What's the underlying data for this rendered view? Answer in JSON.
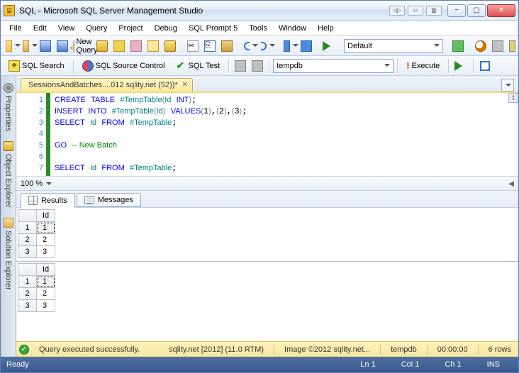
{
  "window": {
    "title": "SQL - Microsoft SQL Server Management Studio"
  },
  "menu": [
    "File",
    "Edit",
    "View",
    "Query",
    "Project",
    "Debug",
    "SQL Prompt 5",
    "Tools",
    "Window",
    "Help"
  ],
  "toolbar1": {
    "new_query": "New Query",
    "config_combo": "Default"
  },
  "toolbar2": {
    "sql_search": "SQL Search",
    "sql_source_control": "SQL Source Control",
    "sql_test": "SQL Test",
    "db_combo": "tempdb",
    "execute": "Execute"
  },
  "sidebar": {
    "properties": "Properties",
    "object_explorer": "Object Explorer",
    "solution_explorer": "Solution Explorer"
  },
  "document_tab": {
    "label": "SessionsAndBatches....012 sqlity.net (52))*"
  },
  "editor": {
    "lines": [
      1,
      2,
      3,
      4,
      5,
      6,
      7
    ],
    "code_plain": "CREATE TABLE #TempTable(Id INT);\nINSERT INTO #TempTable(Id) VALUES(1),(2),(3);\nSELECT Id FROM #TempTable;\n\nGO -- New Batch\n\nSELECT Id FROM #TempTable;"
  },
  "zoom": "100 %",
  "results_tabs": {
    "results": "Results",
    "messages": "Messages"
  },
  "result_sets": [
    {
      "columns": [
        "Id"
      ],
      "rows": [
        [
          1
        ],
        [
          2
        ],
        [
          3
        ]
      ]
    },
    {
      "columns": [
        "Id"
      ],
      "rows": [
        [
          1
        ],
        [
          2
        ],
        [
          3
        ]
      ]
    }
  ],
  "query_status": {
    "message": "Query executed successfully.",
    "server": "sqlity.net [2012] (11.0 RTM)",
    "user": "Image ©2012 sqlity.net...",
    "database": "tempdb",
    "duration": "00:00:00",
    "rowcount": "6 rows"
  },
  "statusbar": {
    "ready": "Ready",
    "line": "Ln 1",
    "col": "Col 1",
    "ch": "Ch 1",
    "ins": "INS"
  }
}
